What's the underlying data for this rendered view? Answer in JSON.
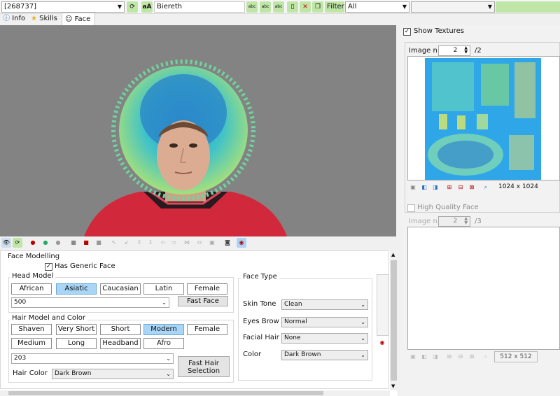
{
  "toolbar": {
    "id_value": "[268737]",
    "font_label": "aA",
    "search_value": "Biereth",
    "filter_label": "Filter",
    "filter_value": "All",
    "abc_label": "abc"
  },
  "tabs": [
    {
      "label": "Info"
    },
    {
      "label": "Skills"
    },
    {
      "label": "Face"
    }
  ],
  "face_modelling": {
    "title": "Face Modelling",
    "generic_face_label": "Has Generic Face",
    "generic_face_checked": true,
    "head_model": {
      "title": "Head Model",
      "buttons": [
        "African",
        "Asiatic",
        "Caucasian",
        "Latin",
        "Female"
      ],
      "selected": "Asiatic",
      "model_value": "500",
      "fast_face_label": "Fast Face"
    },
    "hair": {
      "title": "Hair Model and Color",
      "row1": [
        "Shaven",
        "Very Short",
        "Short",
        "Modern",
        "Female"
      ],
      "row2": [
        "Medium",
        "Long",
        "Headband",
        "Afro"
      ],
      "selected": "Modern",
      "model_value": "203",
      "color_label": "Hair Color",
      "color_value": "Dark Brown",
      "fast_hair_label": "Fast Hair Selection"
    },
    "face_type": {
      "title": "Face Type",
      "skin_tone_label": "Skin Tone",
      "skin_tone_value": "Clean",
      "eyes_brow_label": "Eyes Brow",
      "eyes_brow_value": "Normal",
      "facial_hair_label": "Facial Hair",
      "facial_hair_value": "None",
      "color_label": "Color",
      "color_value": "Dark Brown"
    }
  },
  "textures": {
    "show_label": "Show Textures",
    "show_checked": true,
    "image_n_label": "Image n.",
    "image_n_value": "2",
    "image_total": "/2",
    "size_label": "1024 x 1024"
  },
  "hq_face": {
    "label": "High Quality Face",
    "checked": false,
    "image_n_label": "Image n.",
    "image_n_value": "2",
    "image_total": "/3",
    "size_label": "512 x 512"
  },
  "colors": {
    "accent_selected": "#a9d5f7",
    "viewport_bg": "#838383",
    "hair": "#3ec2c9",
    "jersey": "#d2283c"
  }
}
